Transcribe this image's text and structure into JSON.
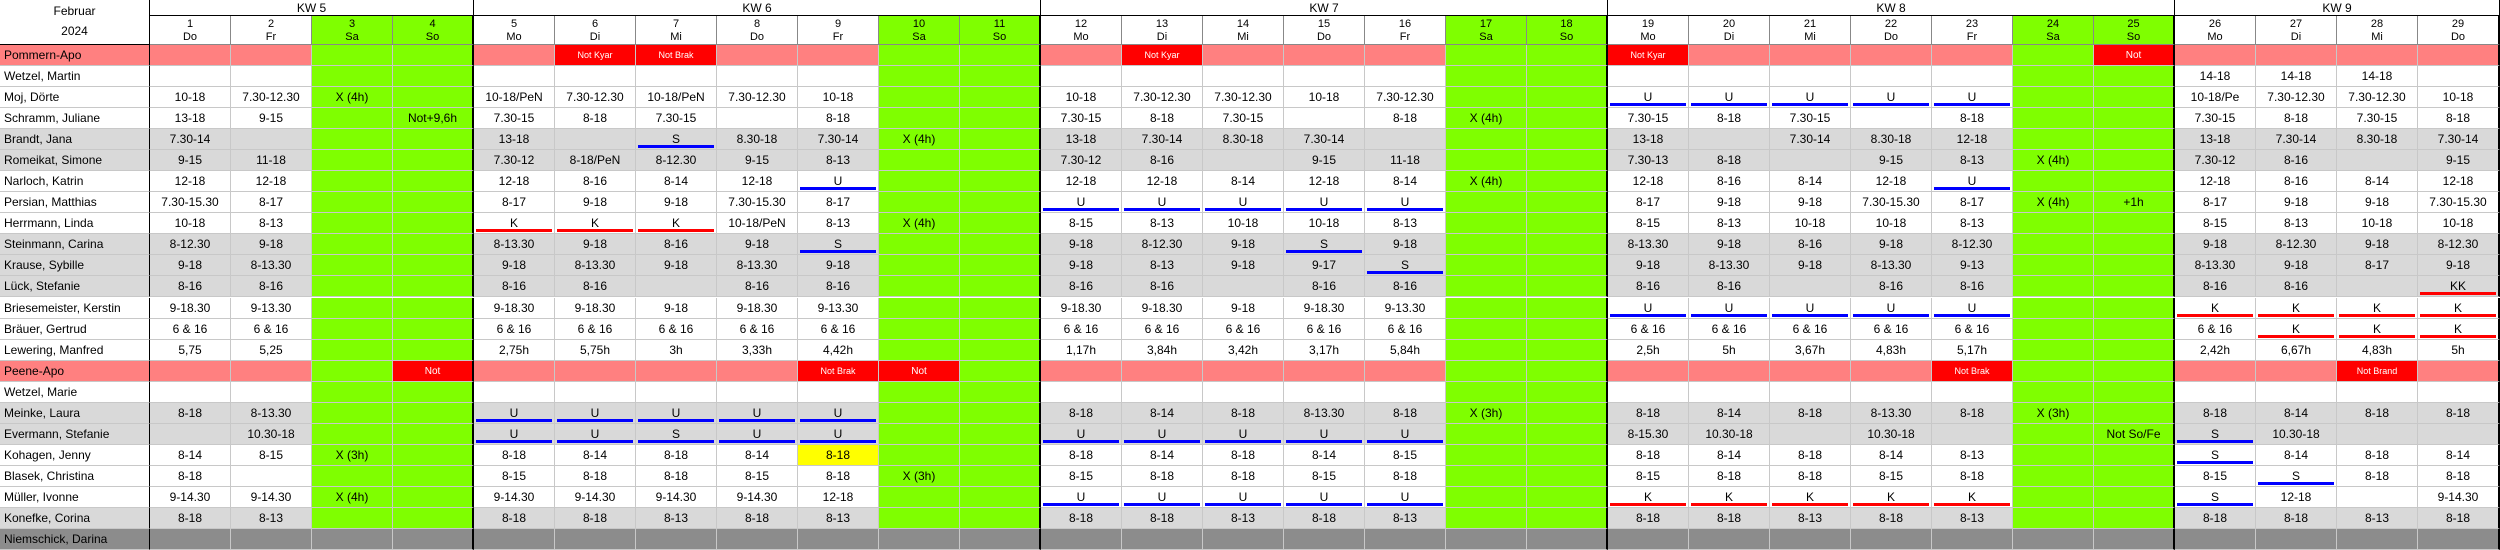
{
  "title": {
    "month": "Februar",
    "year": "2024"
  },
  "colors": {
    "weekend": "#7fff00",
    "red_row": "#ff8080",
    "red_tag": "#ff0000",
    "gray_row": "#d9d9d9",
    "dark_row": "#8c8c8c",
    "blue_line": "#0000ff",
    "red_line": "#ff0000",
    "yellow": "#ffff00"
  },
  "weeks": [
    "KW 5",
    "KW 6",
    "KW 7",
    "KW 8",
    "KW 9"
  ],
  "days": [
    {
      "d": "1",
      "wd": "Do"
    },
    {
      "d": "2",
      "wd": "Fr"
    },
    {
      "d": "3",
      "wd": "Sa"
    },
    {
      "d": "4",
      "wd": "So"
    },
    {
      "d": "5",
      "wd": "Mo"
    },
    {
      "d": "6",
      "wd": "Di"
    },
    {
      "d": "7",
      "wd": "Mi"
    },
    {
      "d": "8",
      "wd": "Do"
    },
    {
      "d": "9",
      "wd": "Fr"
    },
    {
      "d": "10",
      "wd": "Sa"
    },
    {
      "d": "11",
      "wd": "So"
    },
    {
      "d": "12",
      "wd": "Mo"
    },
    {
      "d": "13",
      "wd": "Di"
    },
    {
      "d": "14",
      "wd": "Mi"
    },
    {
      "d": "15",
      "wd": "Do"
    },
    {
      "d": "16",
      "wd": "Fr"
    },
    {
      "d": "17",
      "wd": "Sa"
    },
    {
      "d": "18",
      "wd": "So"
    },
    {
      "d": "19",
      "wd": "Mo"
    },
    {
      "d": "20",
      "wd": "Di"
    },
    {
      "d": "21",
      "wd": "Mi"
    },
    {
      "d": "22",
      "wd": "Do"
    },
    {
      "d": "23",
      "wd": "Fr"
    },
    {
      "d": "24",
      "wd": "Sa"
    },
    {
      "d": "25",
      "wd": "So"
    },
    {
      "d": "26",
      "wd": "Mo"
    },
    {
      "d": "27",
      "wd": "Di"
    },
    {
      "d": "28",
      "wd": "Mi"
    },
    {
      "d": "29",
      "wd": "Do"
    }
  ],
  "rows": [
    {
      "name": "Pommern-Apo",
      "type": "group",
      "cells": [
        "",
        "",
        "",
        "",
        "",
        "Not Kyar",
        "Not Brak",
        "",
        "",
        "",
        "",
        "",
        "Not Kyar",
        "",
        "",
        "",
        "",
        "",
        "Not Kyar",
        "",
        "",
        "",
        "",
        "",
        "Not",
        "",
        "",
        "",
        ""
      ]
    },
    {
      "name": "Wetzel, Martin",
      "type": "white",
      "cells": [
        "",
        "",
        "",
        "",
        "",
        "",
        "",
        "",
        "",
        "",
        "",
        "",
        "",
        "",
        "",
        "",
        "",
        "",
        "",
        "",
        "",
        "",
        "",
        "",
        "",
        "14-18",
        "14-18",
        "14-18",
        ""
      ]
    },
    {
      "name": "Moj, Dörte",
      "type": "white",
      "cells": [
        "10-18",
        "7.30-12.30",
        "X (4h)",
        "",
        "10-18/PeN",
        "7.30-12.30",
        "10-18/PeN",
        "7.30-12.30",
        "10-18",
        "",
        "",
        "10-18",
        "7.30-12.30",
        "7.30-12.30",
        "10-18",
        "7.30-12.30",
        "",
        "",
        "U",
        "U",
        "U",
        "U",
        "U",
        "",
        "",
        "10-18/Pe",
        "7.30-12.30",
        "7.30-12.30",
        "10-18"
      ]
    },
    {
      "name": "Schramm, Juliane",
      "type": "white",
      "cells": [
        "13-18",
        "9-15",
        "",
        "Not+9,6h",
        "7.30-15",
        "8-18",
        "7.30-15",
        "",
        "8-18",
        "",
        "",
        "7.30-15",
        "8-18",
        "7.30-15",
        "",
        "8-18",
        "X (4h)",
        "",
        "7.30-15",
        "8-18",
        "7.30-15",
        "",
        "8-18",
        "",
        "",
        "7.30-15",
        "8-18",
        "7.30-15",
        "8-18"
      ]
    },
    {
      "name": "Brandt, Jana",
      "type": "gray",
      "cells": [
        "7.30-14",
        "",
        "",
        "",
        "13-18",
        "",
        "S",
        "8.30-18",
        "7.30-14",
        "X (4h)",
        "",
        "13-18",
        "7.30-14",
        "8.30-18",
        "7.30-14",
        "",
        "",
        "",
        "13-18",
        "",
        "7.30-14",
        "8.30-18",
        "12-18",
        "",
        "",
        "13-18",
        "7.30-14",
        "8.30-18",
        "7.30-14"
      ]
    },
    {
      "name": "Romeikat, Simone",
      "type": "gray",
      "cells": [
        "9-15",
        "11-18",
        "",
        "",
        "7.30-12",
        "8-18/PeN",
        "8-12.30",
        "9-15",
        "8-13",
        "",
        "",
        "7.30-12",
        "8-16",
        "",
        "9-15",
        "11-18",
        "",
        "",
        "7.30-13",
        "8-18",
        "",
        "9-15",
        "8-13",
        "X (4h)",
        "",
        "7.30-12",
        "8-16",
        "",
        "9-15"
      ]
    },
    {
      "name": "Narloch, Katrin",
      "type": "white",
      "cells": [
        "12-18",
        "12-18",
        "",
        "",
        "12-18",
        "8-16",
        "8-14",
        "12-18",
        "U",
        "",
        "",
        "12-18",
        "12-18",
        "8-14",
        "12-18",
        "8-14",
        "X (4h)",
        "",
        "12-18",
        "8-16",
        "8-14",
        "12-18",
        "U",
        "",
        "",
        "12-18",
        "8-16",
        "8-14",
        "12-18"
      ]
    },
    {
      "name": "Persian, Matthias",
      "type": "white",
      "cells": [
        "7.30-15.30",
        "8-17",
        "",
        "",
        "8-17",
        "9-18",
        "9-18",
        "7.30-15.30",
        "8-17",
        "",
        "",
        "U",
        "U",
        "U",
        "U",
        "U",
        "",
        "",
        "8-17",
        "9-18",
        "9-18",
        "7.30-15.30",
        "8-17",
        "X (4h)",
        "+1h",
        "8-17",
        "9-18",
        "9-18",
        "7.30-15.30"
      ]
    },
    {
      "name": "Herrmann, Linda",
      "type": "white",
      "cells": [
        "10-18",
        "8-13",
        "",
        "",
        "K",
        "K",
        "K",
        "10-18/PeN",
        "8-13",
        "X (4h)",
        "",
        "8-15",
        "8-13",
        "10-18",
        "10-18",
        "8-13",
        "",
        "",
        "8-15",
        "8-13",
        "10-18",
        "10-18",
        "8-13",
        "",
        "",
        "8-15",
        "8-13",
        "10-18",
        "10-18"
      ]
    },
    {
      "name": "Steinmann, Carina",
      "type": "gray",
      "cells": [
        "8-12.30",
        "9-18",
        "",
        "",
        "8-13.30",
        "9-18",
        "8-16",
        "9-18",
        "S",
        "",
        "",
        "9-18",
        "8-12.30",
        "9-18",
        "S",
        "9-18",
        "",
        "",
        "8-13.30",
        "9-18",
        "8-16",
        "9-18",
        "8-12.30",
        "",
        "",
        "9-18",
        "8-12.30",
        "9-18",
        "8-12.30"
      ]
    },
    {
      "name": "Krause, Sybille",
      "type": "gray",
      "cells": [
        "9-18",
        "8-13.30",
        "",
        "",
        "9-18",
        "8-13.30",
        "9-18",
        "8-13.30",
        "9-18",
        "",
        "",
        "9-18",
        "8-13",
        "9-18",
        "9-17",
        "S",
        "",
        "",
        "9-18",
        "8-13.30",
        "9-18",
        "8-13.30",
        "9-13",
        "",
        "",
        "8-13.30",
        "9-18",
        "8-17",
        "9-18"
      ]
    },
    {
      "name": "Lück, Stefanie",
      "type": "gray",
      "cells": [
        "8-16",
        "8-16",
        "",
        "",
        "8-16",
        "8-16",
        "",
        "8-16",
        "8-16",
        "",
        "",
        "8-16",
        "8-16",
        "",
        "8-16",
        "8-16",
        "",
        "",
        "8-16",
        "8-16",
        "",
        "8-16",
        "8-16",
        "",
        "",
        "8-16",
        "8-16",
        "",
        "KK"
      ]
    },
    {
      "name": "Briesemeister, Kerstin",
      "type": "white",
      "cells": [
        "9-18.30",
        "9-13.30",
        "",
        "",
        "9-18.30",
        "9-18.30",
        "9-18",
        "9-18.30",
        "9-13.30",
        "",
        "",
        "9-18.30",
        "9-18.30",
        "9-18",
        "9-18.30",
        "9-13.30",
        "",
        "",
        "U",
        "U",
        "U",
        "U",
        "U",
        "",
        "",
        "K",
        "K",
        "K",
        "K"
      ]
    },
    {
      "name": "Bräuer, Gertrud",
      "type": "white",
      "cells": [
        "6 & 16",
        "6 & 16",
        "",
        "",
        "6 & 16",
        "6 & 16",
        "6 & 16",
        "6 & 16",
        "6 & 16",
        "",
        "",
        "6 & 16",
        "6 & 16",
        "6 & 16",
        "6 & 16",
        "6 & 16",
        "",
        "",
        "6 & 16",
        "6 & 16",
        "6 & 16",
        "6 & 16",
        "6 & 16",
        "",
        "",
        "6 & 16",
        "K",
        "K",
        "K"
      ]
    },
    {
      "name": "Lewering, Manfred",
      "type": "white",
      "cells": [
        "5,75",
        "5,25",
        "",
        "",
        "2,75h",
        "5,75h",
        "3h",
        "3,33h",
        "4,42h",
        "",
        "",
        "1,17h",
        "3,84h",
        "3,42h",
        "3,17h",
        "5,84h",
        "",
        "",
        "2,5h",
        "5h",
        "3,67h",
        "4,83h",
        "5,17h",
        "",
        "",
        "2,42h",
        "6,67h",
        "4,83h",
        "5h"
      ]
    },
    {
      "name": "Peene-Apo",
      "type": "group",
      "cells": [
        "",
        "",
        "",
        "Not",
        "",
        "",
        "",
        "",
        "Not Brak",
        "Not",
        "",
        "",
        "",
        "",
        "",
        "",
        "",
        "",
        "",
        "",
        "",
        "",
        "Not Brak",
        "",
        "",
        "",
        "",
        "Not Brand",
        ""
      ]
    },
    {
      "name": "Wetzel, Marie",
      "type": "white",
      "cells": [
        "",
        "",
        "",
        "",
        "",
        "",
        "",
        "",
        "",
        "",
        "",
        "",
        "",
        "",
        "",
        "",
        "",
        "",
        "",
        "",
        "",
        "",
        "",
        "",
        "",
        "",
        "",
        "",
        ""
      ]
    },
    {
      "name": "Meinke, Laura",
      "type": "gray",
      "cells": [
        "8-18",
        "8-13.30",
        "",
        "",
        "U",
        "U",
        "U",
        "U",
        "U",
        "",
        "",
        "8-18",
        "8-14",
        "8-18",
        "8-13.30",
        "8-18",
        "X (3h)",
        "",
        "8-18",
        "8-14",
        "8-18",
        "8-13.30",
        "8-18",
        "X (3h)",
        "",
        "8-18",
        "8-14",
        "8-18",
        "8-18"
      ]
    },
    {
      "name": "Evermann, Stefanie",
      "type": "gray",
      "cells": [
        "",
        "10.30-18",
        "",
        "",
        "U",
        "U",
        "S",
        "U",
        "U",
        "",
        "",
        "U",
        "U",
        "U",
        "U",
        "U",
        "",
        "",
        "8-15.30",
        "10.30-18",
        "",
        "10.30-18",
        "",
        "",
        "Not So/Fe",
        "S",
        "10.30-18",
        "",
        ""
      ]
    },
    {
      "name": "Kohagen, Jenny",
      "type": "white",
      "cells": [
        "8-14",
        "8-15",
        "X (3h)",
        "",
        "8-18",
        "8-14",
        "8-18",
        "8-14",
        "8-18",
        "",
        "",
        "8-18",
        "8-14",
        "8-18",
        "8-14",
        "8-15",
        "",
        "",
        "8-18",
        "8-14",
        "8-18",
        "8-14",
        "8-13",
        "",
        "",
        "S",
        "8-14",
        "8-18",
        "8-14"
      ]
    },
    {
      "name": "Blasek, Christina",
      "type": "white",
      "cells": [
        "8-18",
        "",
        "",
        "",
        "8-15",
        "8-18",
        "8-18",
        "8-15",
        "8-18",
        "X (3h)",
        "",
        "8-15",
        "8-18",
        "8-18",
        "8-15",
        "8-18",
        "",
        "",
        "8-15",
        "8-18",
        "8-18",
        "8-15",
        "8-18",
        "",
        "",
        "8-15",
        "S",
        "8-18",
        "8-18"
      ]
    },
    {
      "name": "Müller, Ivonne",
      "type": "white",
      "cells": [
        "9-14.30",
        "9-14.30",
        "X (4h)",
        "",
        "9-14.30",
        "9-14.30",
        "9-14.30",
        "9-14.30",
        "12-18",
        "",
        "",
        "U",
        "U",
        "U",
        "U",
        "U",
        "",
        "",
        "K",
        "K",
        "K",
        "K",
        "K",
        "",
        "",
        "S",
        "12-18",
        "",
        "9-14.30"
      ]
    },
    {
      "name": "Konefke, Corina",
      "type": "gray",
      "cells": [
        "8-18",
        "8-13",
        "",
        "",
        "8-18",
        "8-18",
        "8-13",
        "8-18",
        "8-13",
        "",
        "",
        "8-18",
        "8-18",
        "8-13",
        "8-18",
        "8-13",
        "",
        "",
        "8-18",
        "8-18",
        "8-13",
        "8-18",
        "8-13",
        "",
        "",
        "8-18",
        "8-18",
        "8-13",
        "8-18"
      ]
    },
    {
      "name": "Niemschick, Darina",
      "type": "dark",
      "cells": [
        "",
        "",
        "",
        "",
        "",
        "",
        "",
        "",
        "",
        "",
        "",
        "",
        "",
        "",
        "",
        "",
        "",
        "",
        "",
        "",
        "",
        "",
        "",
        "",
        "",
        "",
        "",
        "",
        ""
      ]
    }
  ]
}
